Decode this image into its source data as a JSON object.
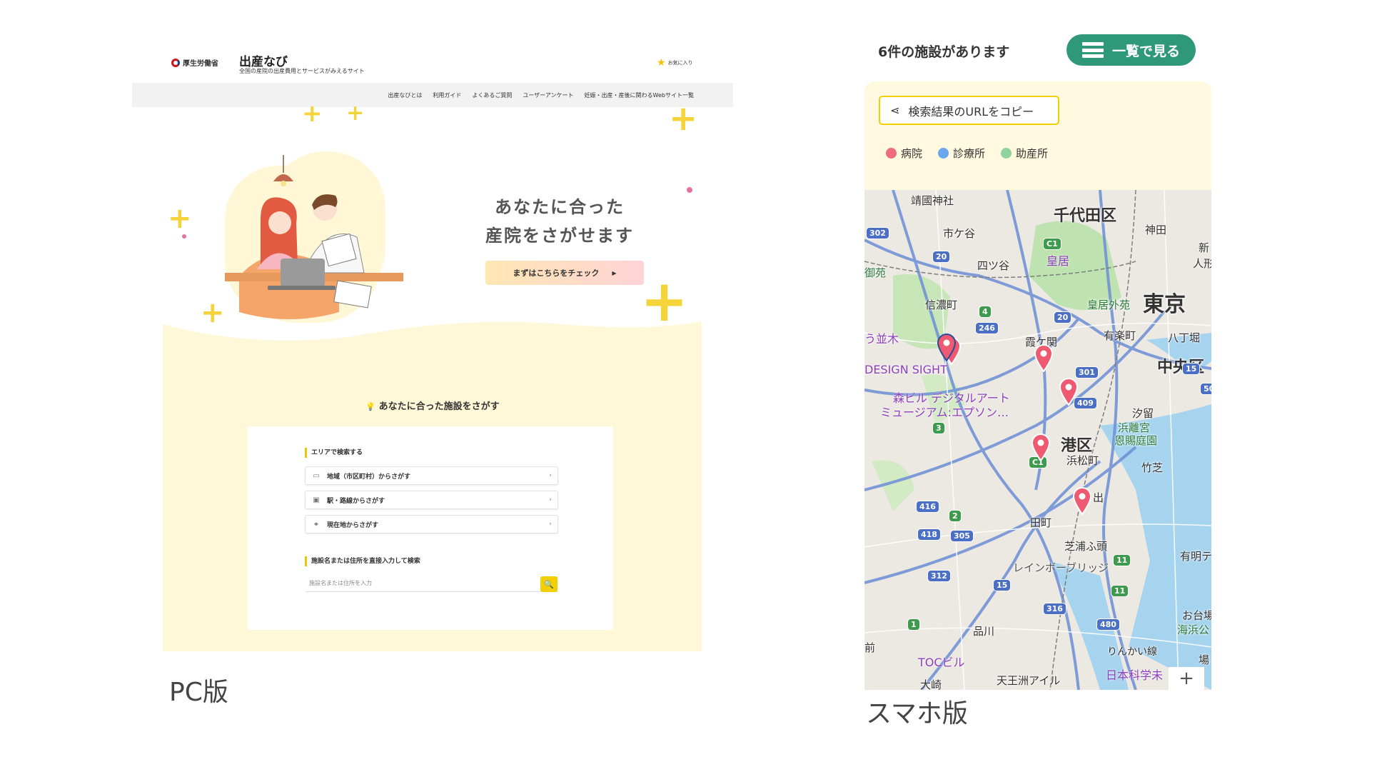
{
  "pc": {
    "ministry_name": "厚生労働省",
    "site_title": "出産なび",
    "site_subtitle": "全国の産院の出産費用とサービスがみえるサイト",
    "favorite_label": "お気に入り",
    "nav": [
      "出産なびとは",
      "利用ガイド",
      "よくあるご質問",
      "ユーザーアンケート",
      "妊娠・出産・産後に関わるWebサイト一覧"
    ],
    "hero_line1": "あなたに合った",
    "hero_line2": "産院をさがせます",
    "cta_label": "まずはこちらをチェック",
    "find_title": "あなたに合った施設をさがす",
    "area_section_label": "エリアで検索する",
    "search_rows": [
      "地域（市区町村）からさがす",
      "駅・路線からさがす",
      "現在地からさがす"
    ],
    "direct_section_label": "施設名または住所を直接入力して検索",
    "search_placeholder": "施設名または住所を入力",
    "caption": "PC版"
  },
  "sp": {
    "count_text": "6件の施設があります",
    "list_button": "一覧で見る",
    "copy_button": "検索結果のURLをコピー",
    "legend": [
      {
        "label": "病院",
        "color": "#f06a7e"
      },
      {
        "label": "診療所",
        "color": "#6aa8ee"
      },
      {
        "label": "助産所",
        "color": "#8fd39f"
      }
    ],
    "map_labels": {
      "chiyoda": "千代田区",
      "tokyo": "東京",
      "chuo": "中央区",
      "minato": "港区",
      "ichigaya": "市ケ谷",
      "yotsuya": "四ツ谷",
      "shinanomachi": "信濃町",
      "kokyo": "皇居",
      "kokyo_gaien": "皇居外苑",
      "kasumigaseki": "霞ケ関",
      "yurakucho": "有楽町",
      "hatchobori": "八丁堀",
      "kanda": "神田",
      "yasukuni": "靖國神社",
      "design_sight": "DESIGN SIGHT",
      "mori_building": "森ビル デジタルアート",
      "museum": "ミュージアム:エプソン…",
      "shiodome": "汐留",
      "hamarikyu": "浜離宮",
      "onshi": "恩賜庭園",
      "hamamatsucho": "浜松町",
      "takeshiba": "竹芝",
      "tamachi": "田町",
      "shibaura": "芝浦ふ頭",
      "rainbow": "レインボーブリッジ",
      "ariake": "有明テ",
      "shinagawa": "品川",
      "daiba": "お台場",
      "kaihin": "海浜公",
      "bay_line": "りんかい線",
      "toc": "TOCビル",
      "tennozu": "天王洲アイル",
      "osaki": "大崎",
      "kagakumi": "日本科学未",
      "namiki": "う並木",
      "en": "御苑",
      "ba": "場",
      "ningyo": "人形",
      "shin": "新",
      "mae": "前",
      "de": "出"
    },
    "route_numbers": [
      "302",
      "20",
      "C1",
      "246",
      "4",
      "20",
      "301",
      "409",
      "15",
      "50",
      "3",
      "C1",
      "416",
      "2",
      "418",
      "305",
      "312",
      "15",
      "316",
      "480",
      "11",
      "11",
      "1"
    ],
    "zoom_in": "+",
    "caption": "スマホ版"
  }
}
